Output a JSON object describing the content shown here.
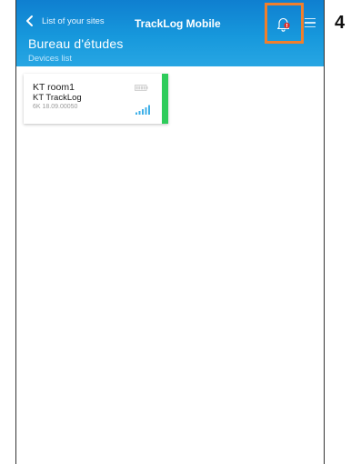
{
  "header": {
    "back_label": "List of your sites",
    "app_title": "TrackLog Mobile",
    "site_name": "Bureau d'études",
    "subtitle": "Devices list"
  },
  "devices": [
    {
      "name": "KT room1",
      "type": "KT TrackLog",
      "serial": "6K 18.09.00050",
      "status_color": "#2ecc5b",
      "battery_icon": "battery-icon",
      "signal_icon": "signal-strength-icon"
    }
  ],
  "annotation": {
    "step_number": "4",
    "highlight_color": "#f07f2c"
  },
  "icons": {
    "back": "chevron-left-icon",
    "notifications": "bell-alert-icon",
    "menu": "hamburger-menu-icon"
  },
  "colors": {
    "header_blue": "#1798dc",
    "alert_red": "#e0312a"
  }
}
